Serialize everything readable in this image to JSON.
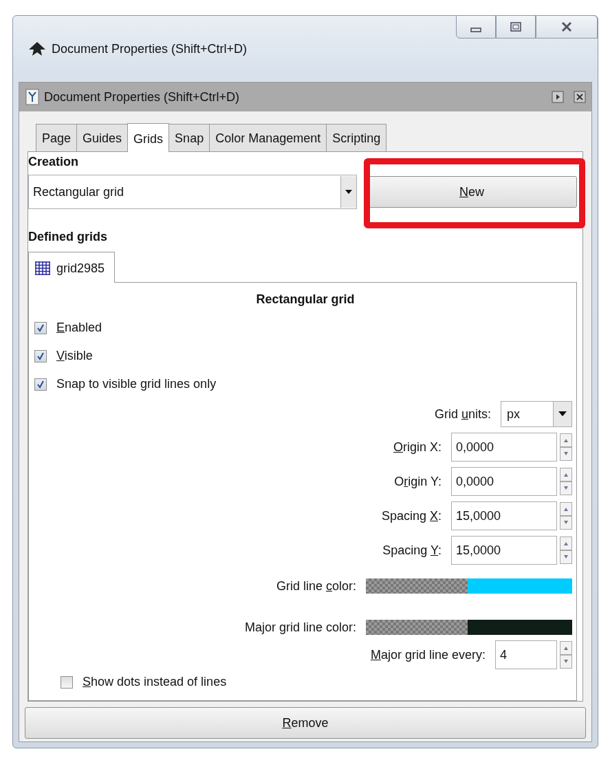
{
  "window": {
    "title": "Document Properties (Shift+Ctrl+D)"
  },
  "panel": {
    "title": "Document Properties (Shift+Ctrl+D)"
  },
  "tabs": [
    {
      "label": "Page",
      "selected": false
    },
    {
      "label": "Guides",
      "selected": false
    },
    {
      "label": "Grids",
      "selected": true
    },
    {
      "label": "Snap",
      "selected": false
    },
    {
      "label": "Color Management",
      "selected": false
    },
    {
      "label": "Scripting",
      "selected": false
    }
  ],
  "creation": {
    "heading": "Creation",
    "grid_type": "Rectangular grid",
    "new_button": {
      "key": "N",
      "post": "ew",
      "highlighted": true
    }
  },
  "defined_grids": {
    "heading": "Defined grids",
    "grid_tabs": [
      {
        "label": "grid2985",
        "selected": true
      }
    ],
    "grid": {
      "heading": "Rectangular grid",
      "checks": [
        {
          "key": "E",
          "post": "nabled",
          "checked": true
        },
        {
          "key": "V",
          "post": "isible",
          "checked": true
        },
        {
          "pre": "Snap to visible grid lines only",
          "checked": true
        }
      ],
      "units": {
        "pre": "Grid ",
        "key": "u",
        "post": "nits:",
        "value": "px"
      },
      "fields": [
        {
          "kind": "spin",
          "key": "O",
          "post": "rigin X:",
          "value": "0,0000"
        },
        {
          "kind": "spin",
          "pre": "O",
          "key": "r",
          "post": "igin Y:",
          "value": "0,0000"
        },
        {
          "kind": "spin",
          "pre": "Spacing ",
          "key": "X",
          "post": ":",
          "value": "15,0000"
        },
        {
          "kind": "spin",
          "pre": "Spacing ",
          "key": "Y",
          "post": ":",
          "value": "15,0000"
        },
        {
          "kind": "color",
          "pre": "Grid line ",
          "key": "c",
          "post": "olor:",
          "color": "#00ccff"
        },
        {
          "kind": "color",
          "pre": "Major grid line color:",
          "color": "#0f1f18"
        },
        {
          "kind": "count",
          "key": "M",
          "post": "ajor grid line every:",
          "value": "4"
        }
      ],
      "dots": {
        "key": "S",
        "post": "how dots instead of lines",
        "checked": false
      }
    },
    "remove_button": {
      "key": "R",
      "post": "emove"
    }
  }
}
